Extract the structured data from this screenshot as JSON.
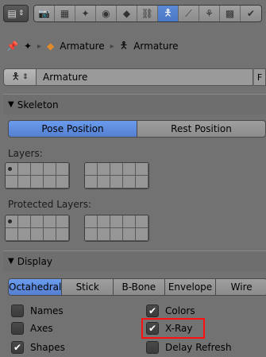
{
  "header": {
    "editor_icon": "properties-editor-icon",
    "context_icons": [
      "render-icon",
      "render-layers-icon",
      "scene-icon",
      "world-icon",
      "object-icon",
      "constraints-icon",
      "armature-data-icon",
      "bone-icon",
      "bone-constraint-icon",
      "texture-icon",
      "physics-icon"
    ],
    "active_context": "armature-data-icon"
  },
  "breadcrumb": {
    "pin_icon": "pin-icon",
    "scene_icon": "scene-icon",
    "object_label": "Armature",
    "data_label": "Armature"
  },
  "datablock": {
    "name": "Armature",
    "fake_user": "F"
  },
  "skeleton": {
    "title": "Skeleton",
    "pose_position": "Pose Position",
    "rest_position": "Rest Position",
    "layers_label": "Layers:",
    "protected_layers_label": "Protected Layers:"
  },
  "display": {
    "title": "Display",
    "types": [
      "Octahedral",
      "Stick",
      "B-Bone",
      "Envelope",
      "Wire"
    ],
    "active_type": "Octahedral",
    "options": {
      "names": {
        "label": "Names",
        "checked": false
      },
      "colors": {
        "label": "Colors",
        "checked": true
      },
      "axes": {
        "label": "Axes",
        "checked": false
      },
      "xray": {
        "label": "X-Ray",
        "checked": true
      },
      "shapes": {
        "label": "Shapes",
        "checked": true
      },
      "delay_refresh": {
        "label": "Delay Refresh",
        "checked": false
      }
    }
  },
  "colors": {
    "background": "#727272",
    "active_blue": "#5680d2",
    "highlight_red": "#ff1010"
  }
}
